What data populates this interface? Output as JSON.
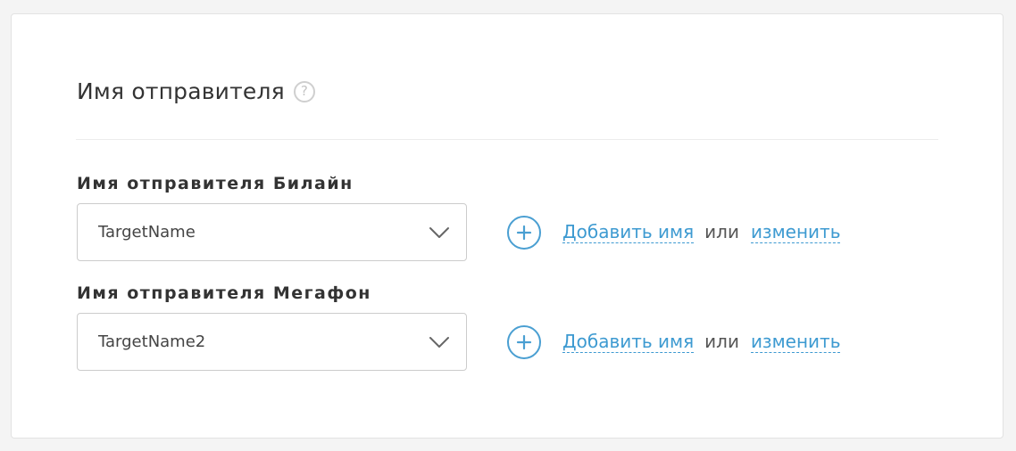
{
  "section": {
    "title": "Имя отправителя",
    "help_icon": "?"
  },
  "fields": [
    {
      "label": "Имя отправителя Билайн",
      "selected_value": "TargetName",
      "add_link": "Добавить имя",
      "or_text": "или",
      "edit_link": "изменить"
    },
    {
      "label": "Имя отправителя Мегафон",
      "selected_value": "TargetName2",
      "add_link": "Добавить имя",
      "or_text": "или",
      "edit_link": "изменить"
    }
  ],
  "colors": {
    "accent": "#3d9ad1",
    "text": "#333333",
    "border": "#cccccc",
    "background": "#f4f4f4"
  }
}
